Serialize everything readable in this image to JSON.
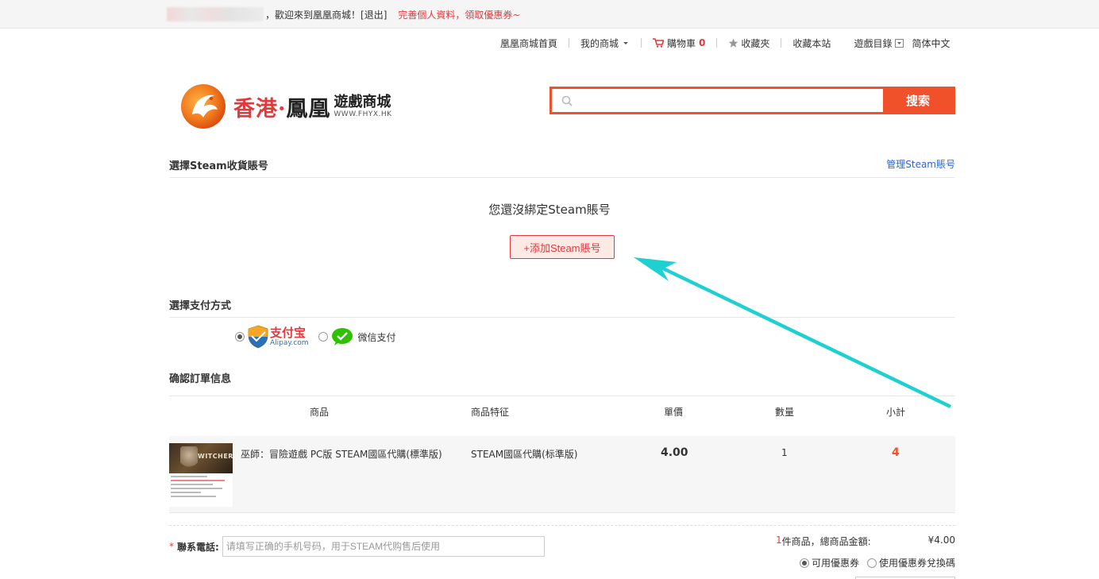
{
  "topbar": {
    "welcome": "，歡迎來到凰凰商城！",
    "logout": "[退出]",
    "promo": "完善個人資料，領取優惠券~"
  },
  "subnav": {
    "home": "凰凰商城首頁",
    "my_mall": "我的商城",
    "cart": "購物車",
    "cart_count": "0",
    "favorites": "收藏夾",
    "bookmark": "收藏本站",
    "catalog": "遊戲目錄",
    "language": "简体中文"
  },
  "logo": {
    "main_red": "香港",
    "dot": "·",
    "main_black": "鳳凰",
    "sub_cn": "遊戲商城",
    "sub_en": "WWW.FHYX.HK"
  },
  "search": {
    "placeholder": "",
    "button": "搜索"
  },
  "steam_section": {
    "title": "選擇Steam收貨賬号",
    "manage_link": "管理Steam賬号",
    "empty_msg": "您還沒綁定Steam賬号",
    "add_button": "+添加Steam賬号"
  },
  "payment_section": {
    "title": "選擇支付方式",
    "alipay_cn": "支付宝",
    "alipay_en": "Alipay.com",
    "wechat_label": "微信支付"
  },
  "order_section": {
    "title": "确認訂單信息",
    "columns": [
      "商品",
      "商品特征",
      "單價",
      "數量",
      "小計"
    ],
    "item": {
      "thumb_text": "WITCHER",
      "name": "巫師：冒險遊戲 PC版 STEAM國區代購(標準版)",
      "feature": "STEAM國區代購(标準版)",
      "price": "4.00",
      "qty": "1",
      "subtotal": "4"
    }
  },
  "contact": {
    "star": "*",
    "label": "聯系電話:",
    "placeholder": "请填写正确的手机号码，用于STEAM代购售后使用"
  },
  "summary": {
    "count": "1",
    "count_text": "件商品，總商品金額:",
    "amount": "¥4.00"
  },
  "coupons": {
    "available": "可用優惠券",
    "redeem": "使用優惠券兌換碼"
  },
  "colors": {
    "accent": "#f0502a",
    "red": "#e4393c",
    "link": "#2a67c9",
    "annotation": "#1fd0d0"
  }
}
